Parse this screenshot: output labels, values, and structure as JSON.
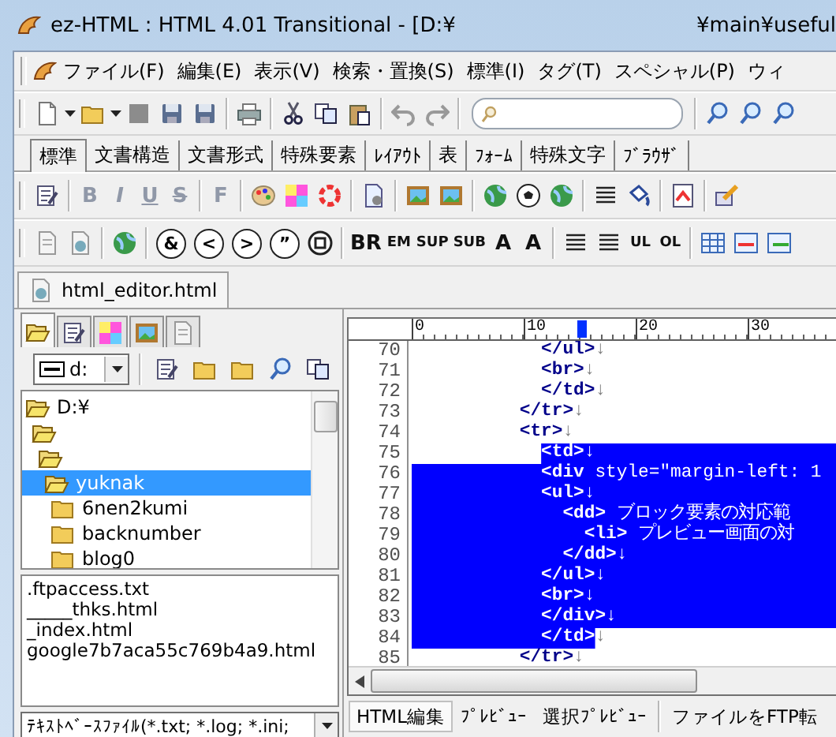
{
  "window": {
    "title": "ez-HTML : HTML 4.01 Transitional - [D:¥",
    "title_tail": "¥main¥useful"
  },
  "menu": [
    "ファイル(F)",
    "編集(E)",
    "表示(V)",
    "検索・置換(S)",
    "標準(I)",
    "タグ(T)",
    "スペシャル(P)",
    "ウィ"
  ],
  "palette_tabs": [
    {
      "label": "標準",
      "selected": true
    },
    {
      "label": "文書構造",
      "selected": false
    },
    {
      "label": "文書形式",
      "selected": false
    },
    {
      "label": "特殊要素",
      "selected": false
    },
    {
      "label": "ﾚｲｱｳﾄ",
      "selected": false
    },
    {
      "label": "表",
      "selected": false
    },
    {
      "label": "ﾌｫｰﾑ",
      "selected": false
    },
    {
      "label": "特殊文字",
      "selected": false
    },
    {
      "label": "ﾌﾞﾗｳｻﾞ",
      "selected": false
    }
  ],
  "format_buttons": [
    "B",
    "I",
    "U",
    "S",
    "F"
  ],
  "entity_buttons": [
    "&",
    "<",
    ">",
    "”"
  ],
  "tag_buttons": [
    "BR",
    "EM",
    "SUP",
    "SUB",
    "A",
    "A"
  ],
  "list_buttons": [
    "UL",
    "OL"
  ],
  "document_tab": "html_editor.html",
  "explorer": {
    "side_tabs": [
      {
        "selected": true
      },
      {
        "selected": false
      },
      {
        "selected": false
      },
      {
        "selected": false
      },
      {
        "selected": false
      }
    ],
    "drive": "d:",
    "tree": [
      {
        "name": "D:¥",
        "expanded": true,
        "selected": false,
        "children": [
          {
            "expanded": true,
            "selected": false,
            "children": [
              {
                "expanded": true,
                "selected": false,
                "children": [
                  {
                    "name": "yuknak",
                    "expanded": true,
                    "selected": true,
                    "children": [
                      {
                        "name": "6nen2kumi",
                        "expanded": false,
                        "selected": false
                      },
                      {
                        "name": "backnumber",
                        "expanded": false,
                        "selected": false
                      },
                      {
                        "name": "blog0",
                        "expanded": false,
                        "selected": false
                      }
                    ]
                  }
                ]
              }
            ]
          }
        ]
      }
    ],
    "files": [
      ".ftpaccess.txt",
      "_____thks.html",
      "_index.html",
      "google7b7aca55c769b4a9.html"
    ],
    "filter": "ﾃｷｽﾄﾍﾞｰｽﾌｧｲﾙ(*.txt; *.log; *.ini;"
  },
  "editor": {
    "ruler": [
      "0",
      "10",
      "20",
      "30"
    ],
    "lines": [
      {
        "number": "70",
        "tag": "            </ul>",
        "eol": "↓",
        "selected": false,
        "margin_selected": false,
        "end_selected": false
      },
      {
        "number": "71",
        "tag": "            <br>",
        "eol": "↓",
        "selected": false,
        "margin_selected": false,
        "end_selected": false
      },
      {
        "number": "72",
        "tag": "            </td>",
        "eol": "↓",
        "selected": false,
        "margin_selected": false,
        "end_selected": false
      },
      {
        "number": "73",
        "tag": "          </tr>",
        "eol": "↓",
        "selected": false,
        "margin_selected": false,
        "end_selected": false
      },
      {
        "number": "74",
        "tag": "          <tr>",
        "eol": "↓",
        "selected": false,
        "margin_selected": false,
        "end_selected": false
      },
      {
        "number": "75",
        "tag": "            <td>",
        "eol": "↓",
        "selected": true,
        "margin_selected": false,
        "end_selected": true
      },
      {
        "number": "76",
        "tag": "            <div",
        "rest": " style=\"margin-left: 1",
        "selected": true,
        "margin_selected": true,
        "end_selected": true
      },
      {
        "number": "77",
        "tag": "            <ul>",
        "eol": "↓",
        "selected": true,
        "margin_selected": true,
        "end_selected": true
      },
      {
        "number": "78",
        "tag": "              <dd>",
        "rest": " ブロック要素の対応範",
        "selected": true,
        "margin_selected": true,
        "end_selected": true
      },
      {
        "number": "79",
        "tag": "                <li>",
        "rest": " プレビュー画面の対",
        "selected": true,
        "margin_selected": true,
        "end_selected": true
      },
      {
        "number": "80",
        "tag": "              </dd>",
        "eol": "↓",
        "selected": true,
        "margin_selected": true,
        "end_selected": true
      },
      {
        "number": "81",
        "tag": "            </ul>",
        "eol": "↓",
        "selected": true,
        "margin_selected": true,
        "end_selected": true
      },
      {
        "number": "82",
        "tag": "            <br>",
        "eol": "↓",
        "selected": true,
        "margin_selected": true,
        "end_selected": true
      },
      {
        "number": "83",
        "tag": "            </div>",
        "eol": "↓",
        "selected": true,
        "margin_selected": true,
        "end_selected": true
      },
      {
        "number": "84",
        "tag": "            </td>",
        "eol": "↓",
        "selected": true,
        "margin_selected": true,
        "end_selected": false
      },
      {
        "number": "85",
        "tag": "          </tr>",
        "eol": "↓",
        "selected": false,
        "margin_selected": false,
        "end_selected": false
      }
    ]
  },
  "bottom_tabs": [
    {
      "label": "HTML編集",
      "selected": true
    },
    {
      "label": "ﾌﾟﾚﾋﾞｭｰ",
      "selected": false
    },
    {
      "label": "選択ﾌﾟﾚﾋﾞｭｰ",
      "selected": false
    },
    {
      "label": "ファイルをFTP転",
      "selected": false
    }
  ]
}
